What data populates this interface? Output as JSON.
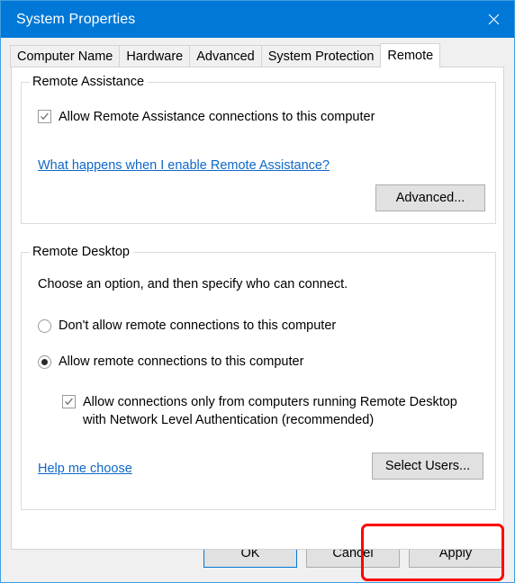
{
  "window": {
    "title": "System Properties",
    "close_icon": "close-icon",
    "border_color": "#3f9ee0",
    "titlebar_color": "#0078d7"
  },
  "tabs": [
    {
      "label": "Computer Name",
      "active": false
    },
    {
      "label": "Hardware",
      "active": false
    },
    {
      "label": "Advanced",
      "active": false
    },
    {
      "label": "System Protection",
      "active": false
    },
    {
      "label": "Remote",
      "active": true
    }
  ],
  "remote_assistance": {
    "group_label": "Remote Assistance",
    "checkbox": {
      "label": "Allow Remote Assistance connections to this computer",
      "checked": true
    },
    "link": "What happens when I enable Remote Assistance?",
    "advanced_button": "Advanced..."
  },
  "remote_desktop": {
    "group_label": "Remote Desktop",
    "instruction": "Choose an option, and then specify who can connect.",
    "radios": [
      {
        "label": "Don't allow remote connections to this computer",
        "selected": false
      },
      {
        "label": "Allow remote connections to this computer",
        "selected": true
      }
    ],
    "nla_checkbox": {
      "line1": "Allow connections only from computers running Remote Desktop",
      "line2": "with Network Level Authentication (recommended)",
      "checked": true
    },
    "help_link": "Help me choose",
    "select_users_button": "Select Users..."
  },
  "annotation": {
    "target": "select-users-button",
    "color": "#ff0000"
  },
  "footer": {
    "ok": "OK",
    "cancel": "Cancel",
    "apply": "Apply"
  }
}
